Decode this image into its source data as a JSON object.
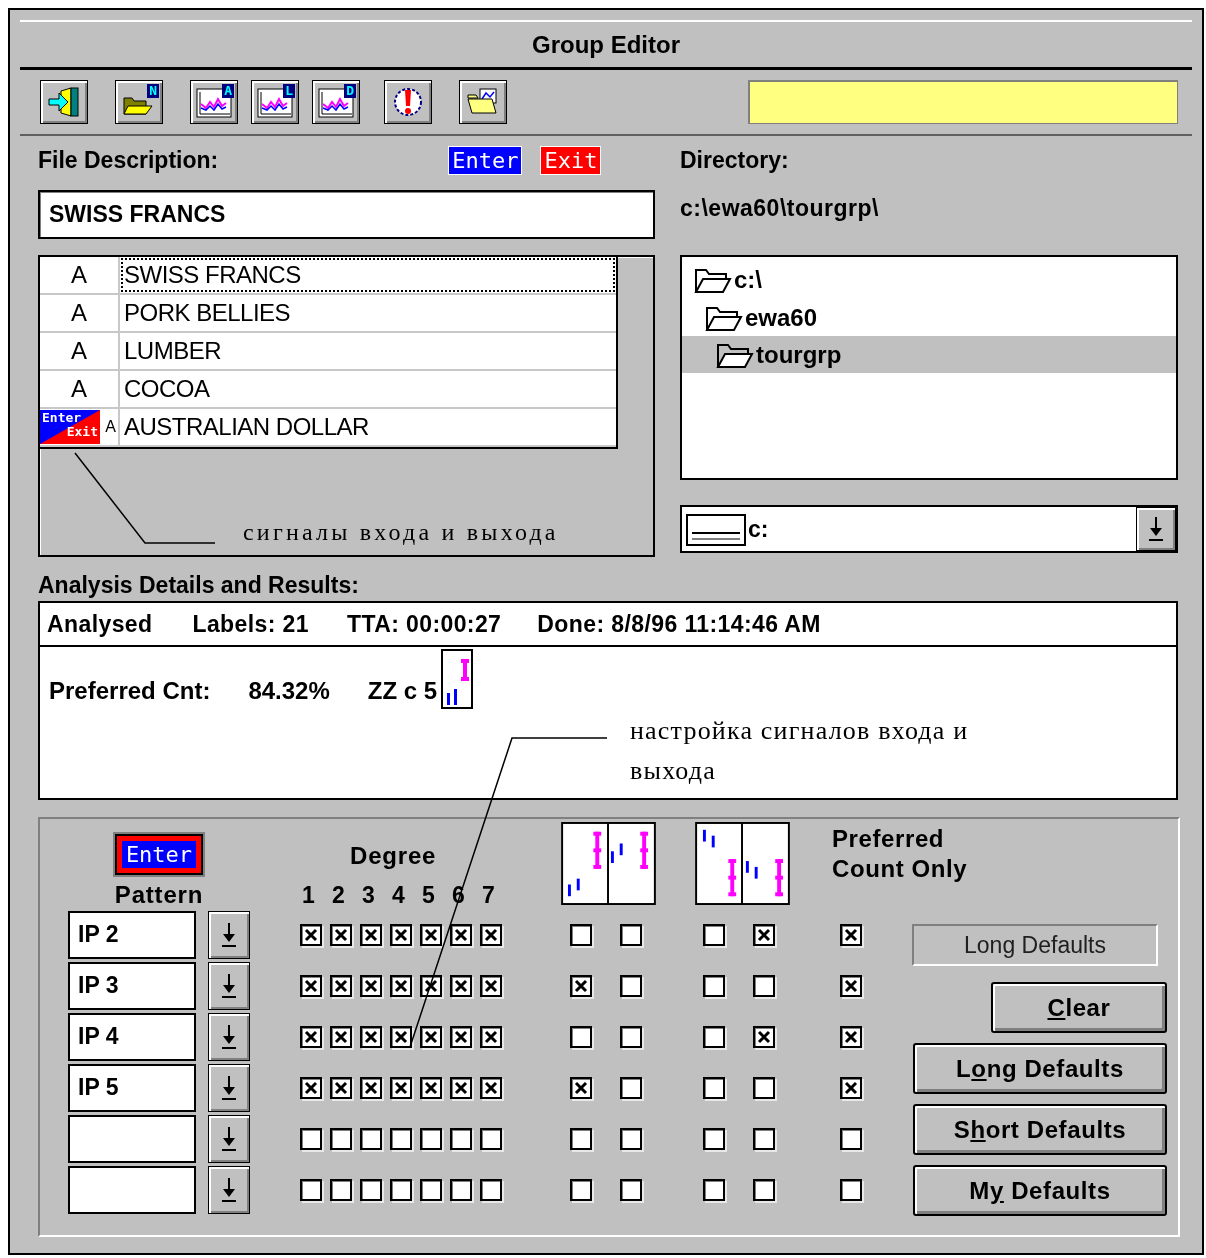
{
  "window": {
    "title": "Group Editor"
  },
  "toolbar": {
    "buttons": [
      {
        "kind": "exit"
      },
      {
        "kind": "open",
        "badge": "N"
      },
      {
        "kind": "chart",
        "badge": "A"
      },
      {
        "kind": "chart",
        "badge": "L"
      },
      {
        "kind": "chart",
        "badge": "D"
      },
      {
        "kind": "alert"
      },
      {
        "kind": "folder-chart"
      }
    ]
  },
  "file_description": {
    "label": "File Description:",
    "enter_badge": "Enter",
    "exit_badge": "Exit",
    "value": "SWISS FRANCS"
  },
  "symbols": [
    {
      "type": "A",
      "name": "SWISS FRANCS",
      "selected": true
    },
    {
      "type": "A",
      "name": "PORK BELLIES",
      "selected": false
    },
    {
      "type": "A",
      "name": "LUMBER",
      "selected": false
    },
    {
      "type": "A",
      "name": "COCOA",
      "selected": false
    },
    {
      "type": "A",
      "name": "AUSTRALIAN DOLLAR",
      "selected": false,
      "signal": {
        "enter": "Enter",
        "exit": "Exit"
      }
    }
  ],
  "symbols_note": "сигналы входа и выхода",
  "directory": {
    "label": "Directory:",
    "path": "c:\\ewa60\\tourgrp\\",
    "tree": [
      {
        "name": "c:\\",
        "selected": false,
        "children": [
          {
            "name": "ewa60",
            "selected": false,
            "children": [
              {
                "name": "tourgrp",
                "selected": true
              }
            ]
          }
        ]
      }
    ],
    "drive": "c:"
  },
  "analysis": {
    "label": "Analysis Details and Results:",
    "summary": [
      "Analysed",
      "Labels: 21",
      "TTA: 00:00:27",
      "Done: 8/8/96 11:14:46 AM"
    ],
    "preferred_label": "Preferred Cnt:",
    "preferred_value": "84.32%",
    "pattern_code": "ZZ c 5",
    "note": "настройка сигналов входа и выхода"
  },
  "settings": {
    "enter_button": "Enter",
    "pattern_label": "Pattern",
    "degree_label": "Degree",
    "degrees": [
      "1",
      "2",
      "3",
      "4",
      "5",
      "6",
      "7"
    ],
    "preferred_label": "Preferred Count Only",
    "rows": [
      {
        "pattern": "IP 2",
        "degrees": [
          true,
          true,
          true,
          true,
          true,
          true,
          true
        ],
        "long": [
          false,
          false
        ],
        "short": [
          false,
          true
        ],
        "preferred": true
      },
      {
        "pattern": "IP 3",
        "degrees": [
          true,
          true,
          true,
          true,
          true,
          true,
          true
        ],
        "long": [
          true,
          false
        ],
        "short": [
          false,
          false
        ],
        "preferred": true
      },
      {
        "pattern": "IP 4",
        "degrees": [
          true,
          true,
          true,
          true,
          true,
          true,
          true
        ],
        "long": [
          false,
          false
        ],
        "short": [
          false,
          true
        ],
        "preferred": true
      },
      {
        "pattern": "IP 5",
        "degrees": [
          true,
          true,
          true,
          true,
          true,
          true,
          true
        ],
        "long": [
          true,
          false
        ],
        "short": [
          false,
          false
        ],
        "preferred": true
      },
      {
        "degrees": [
          false,
          false,
          false,
          false,
          false,
          false,
          false
        ],
        "long": [
          false,
          false
        ],
        "short": [
          false,
          false
        ],
        "preferred": false
      },
      {
        "degrees": [
          false,
          false,
          false,
          false,
          false,
          false,
          false
        ],
        "long": [
          false,
          false
        ],
        "short": [
          false,
          false
        ],
        "preferred": false
      }
    ],
    "mode_field": "Long Defaults",
    "buttons": [
      {
        "key": "C",
        "after": "lear"
      },
      {
        "before": "L",
        "key": "o",
        "after": "ng Defaults"
      },
      {
        "before": "S",
        "key": "h",
        "after": "ort Defaults"
      },
      {
        "before": "M",
        "key": "y",
        "after": " Defaults"
      }
    ]
  }
}
